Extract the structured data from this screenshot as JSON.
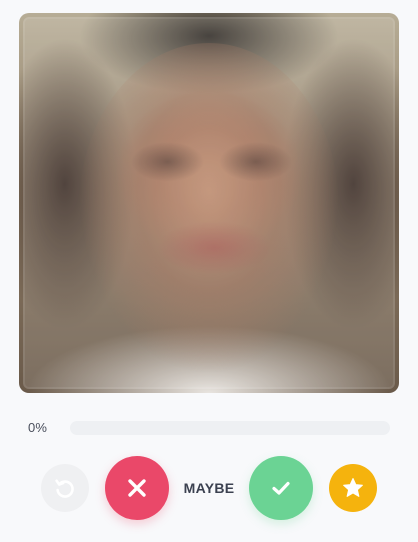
{
  "progress": {
    "label": "0%",
    "value": 0
  },
  "actions": {
    "undo": {
      "icon": "undo-icon",
      "disabled": true
    },
    "dislike": {
      "icon": "close-icon"
    },
    "maybe_label": "MAYBE",
    "like": {
      "icon": "check-icon"
    },
    "super_like": {
      "icon": "star-icon"
    }
  },
  "colors": {
    "dislike": "#ea4869",
    "like": "#6bd394",
    "star": "#f5b30d",
    "undo_bg": "#eff0f2",
    "track": "#eef0f3"
  }
}
